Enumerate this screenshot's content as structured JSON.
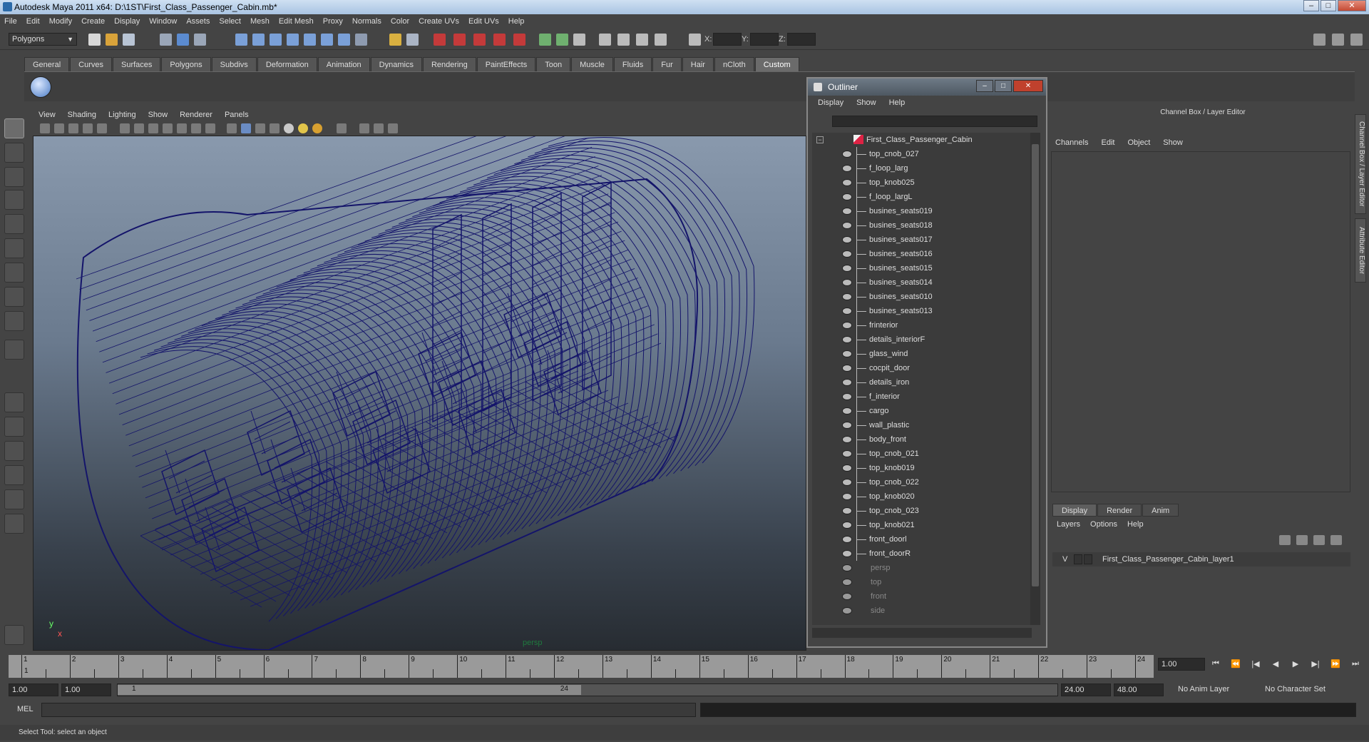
{
  "window": {
    "title": "Autodesk Maya 2011 x64: D:\\1ST\\First_Class_Passenger_Cabin.mb*"
  },
  "menubar": [
    "File",
    "Edit",
    "Modify",
    "Create",
    "Display",
    "Window",
    "Assets",
    "Select",
    "Mesh",
    "Edit Mesh",
    "Proxy",
    "Normals",
    "Color",
    "Create UVs",
    "Edit UVs",
    "Help"
  ],
  "statusline": {
    "mode": "Polygons",
    "x_label": "X:",
    "y_label": "Y:",
    "z_label": "Z:"
  },
  "shelf": {
    "tabs": [
      "General",
      "Curves",
      "Surfaces",
      "Polygons",
      "Subdivs",
      "Deformation",
      "Animation",
      "Dynamics",
      "Rendering",
      "PaintEffects",
      "Toon",
      "Muscle",
      "Fluids",
      "Fur",
      "Hair",
      "nCloth",
      "Custom"
    ],
    "active_tab": "Custom"
  },
  "viewport": {
    "menu": [
      "View",
      "Shading",
      "Lighting",
      "Show",
      "Renderer",
      "Panels"
    ],
    "camera": "persp",
    "axis_y": "y",
    "axis_x": "x",
    "wire_color": "#14146a"
  },
  "outliner": {
    "title": "Outliner",
    "menu": [
      "Display",
      "Show",
      "Help"
    ],
    "root": "First_Class_Passenger_Cabin",
    "children": [
      "top_cnob_027",
      "f_loop_larg",
      "top_knob025",
      "f_loop_largL",
      "busines_seats019",
      "busines_seats018",
      "busines_seats017",
      "busines_seats016",
      "busines_seats015",
      "busines_seats014",
      "busines_seats010",
      "busines_seats013",
      "frinterior",
      "details_interiorF",
      "glass_wind",
      "cocpit_door",
      "details_iron",
      "f_interior",
      "cargo",
      "wall_plastic",
      "body_front",
      "top_cnob_021",
      "top_knob019",
      "top_cnob_022",
      "top_knob020",
      "top_cnob_023",
      "top_knob021",
      "front_doorl",
      "front_doorR"
    ],
    "cameras": [
      "persp",
      "top",
      "front",
      "side"
    ]
  },
  "channelbox": {
    "header": "Channel Box / Layer Editor",
    "menu": [
      "Channels",
      "Edit",
      "Object",
      "Show"
    ],
    "side_tabs": [
      "Channel Box / Layer Editor",
      "Attribute Editor"
    ]
  },
  "layer_editor": {
    "tabs": [
      "Display",
      "Render",
      "Anim"
    ],
    "active_tab": "Display",
    "menu": [
      "Layers",
      "Options",
      "Help"
    ],
    "layer_visible": "V",
    "layer_name": "First_Class_Passenger_Cabin_layer1"
  },
  "timeline": {
    "frames": [
      "1",
      "2",
      "3",
      "4",
      "5",
      "6",
      "7",
      "8",
      "9",
      "10",
      "11",
      "12",
      "13",
      "14",
      "15",
      "16",
      "17",
      "18",
      "19",
      "20",
      "21",
      "22",
      "23",
      "24"
    ],
    "current_frame": "1.00",
    "marker": "1"
  },
  "range": {
    "start_time": "1.00",
    "playback_start": "1.00",
    "range_start": "1",
    "range_end": "24",
    "playback_end": "24.00",
    "end_time": "48.00",
    "anim_layer": "No Anim Layer",
    "character_set": "No Character Set"
  },
  "commandline": {
    "label": "MEL"
  },
  "helpline": {
    "text": "Select Tool: select an object"
  }
}
